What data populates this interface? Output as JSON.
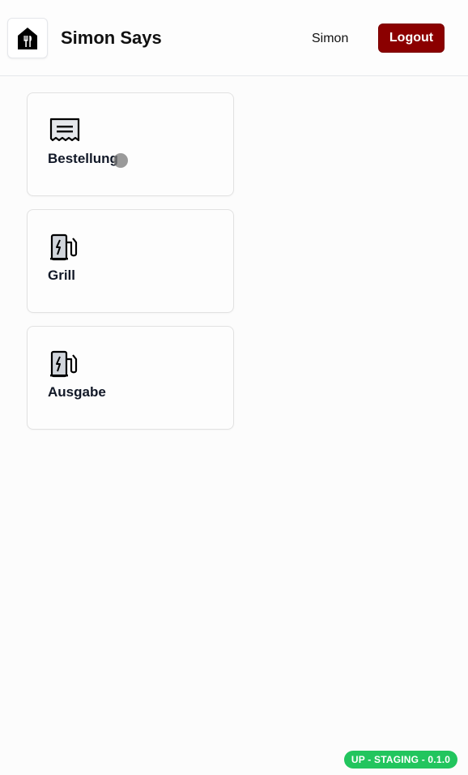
{
  "header": {
    "app_title": "Simon Says",
    "logo_icon": "restaurant-icon",
    "user_name": "Simon",
    "logout_label": "Logout",
    "logout_color": "#8b0000"
  },
  "cards": [
    {
      "label": "Bestellung",
      "icon": "receipt-icon"
    },
    {
      "label": "Grill",
      "icon": "fuel-station-icon"
    },
    {
      "label": "Ausgabe",
      "icon": "fuel-station-icon"
    }
  ],
  "footer": {
    "version_badge": "UP - STAGING - 0.1.0",
    "badge_color": "#22c55e"
  }
}
